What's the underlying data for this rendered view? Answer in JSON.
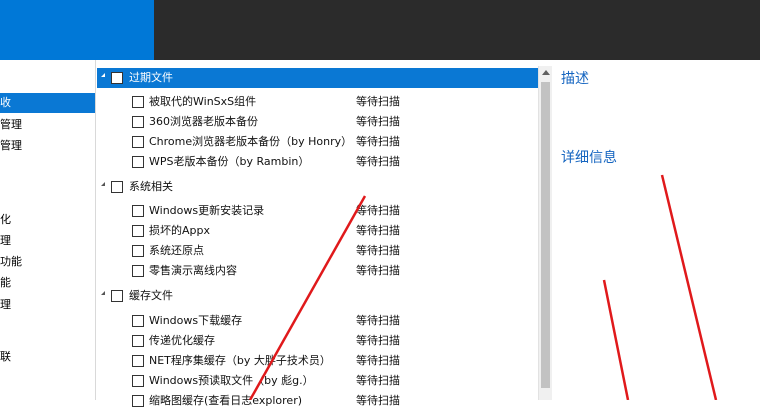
{
  "sidebar": {
    "items": [
      {
        "label": "收",
        "selected": true
      },
      {
        "label": "管理"
      },
      {
        "label": "管理"
      },
      {
        "label": "化"
      },
      {
        "label": "理"
      },
      {
        "label": "功能"
      },
      {
        "label": "能"
      },
      {
        "label": "理"
      },
      {
        "label": "联"
      }
    ]
  },
  "tree": {
    "categories": [
      {
        "label": "过期文件",
        "items": [
          {
            "label": "被取代的WinSxS组件",
            "status": "等待扫描"
          },
          {
            "label": "360浏览器老版本备份",
            "status": "等待扫描"
          },
          {
            "label": "Chrome浏览器老版本备份（by Honry）",
            "status": "等待扫描"
          },
          {
            "label": "WPS老版本备份（by Rambin）",
            "status": "等待扫描"
          }
        ]
      },
      {
        "label": "系统相关",
        "items": [
          {
            "label": "Windows更新安装记录",
            "status": "等待扫描"
          },
          {
            "label": "损坏的Appx",
            "status": "等待扫描"
          },
          {
            "label": "系统还原点",
            "status": "等待扫描"
          },
          {
            "label": "零售演示离线内容",
            "status": "等待扫描"
          }
        ]
      },
      {
        "label": "缓存文件",
        "items": [
          {
            "label": "Windows下载缓存",
            "status": "等待扫描"
          },
          {
            "label": "传递优化缓存",
            "status": "等待扫描"
          },
          {
            "label": "NET程序集缓存（by 大胖子技术员）",
            "status": "等待扫描"
          },
          {
            "label": "Windows预读取文件（by 彪g.）",
            "status": "等待扫描"
          },
          {
            "label": "缩略图缓存(查看日志explorer)",
            "status": "等待扫描"
          }
        ]
      }
    ]
  },
  "detail": {
    "description_label": "描述",
    "details_label": "详细信息"
  },
  "colors": {
    "accent": "#0078d7",
    "selection": "#0a78d4",
    "annotation": "#e0191b",
    "titlebar": "#2b2b2b",
    "heading": "#1565c0"
  }
}
